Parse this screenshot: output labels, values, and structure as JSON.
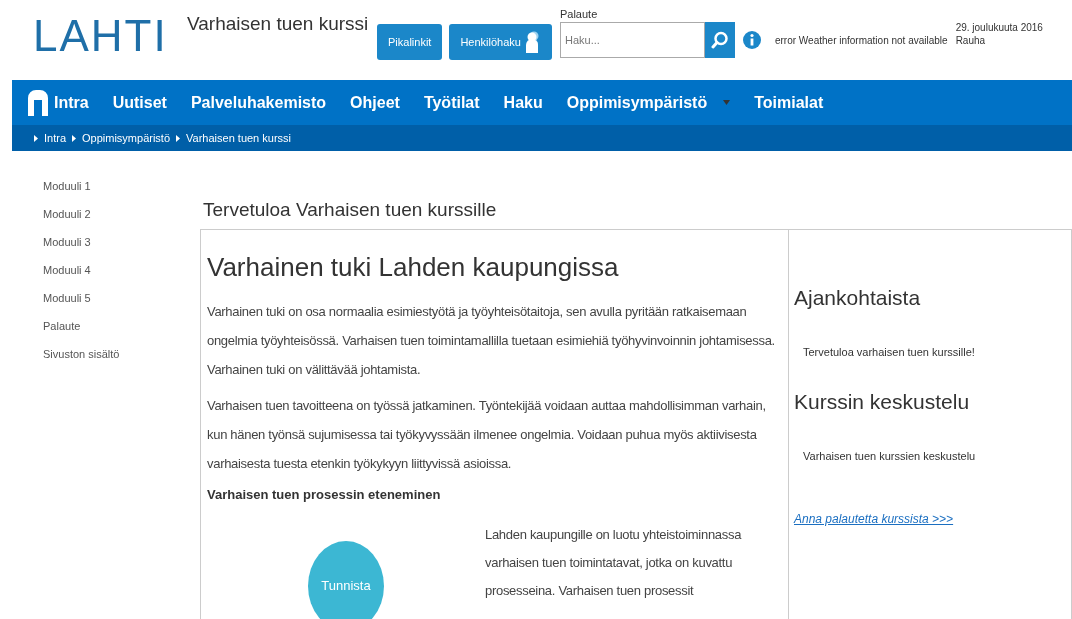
{
  "header": {
    "logo": "LAHTI",
    "site_title": "Varhaisen tuen kurssi",
    "buttons": [
      {
        "label": "Pikalinkit",
        "kind": "plain"
      },
      {
        "label": "Henkilöhaku",
        "kind": "person"
      }
    ],
    "search": {
      "label": "Palaute",
      "placeholder": "Haku..."
    },
    "weather": "error Weather information not available",
    "date": "29. joulukuuta 2016",
    "name_day": "Rauha"
  },
  "nav": {
    "items": [
      {
        "label": "Intra",
        "kind": "home",
        "dropdown": false
      },
      {
        "label": "Uutiset",
        "kind": "link",
        "dropdown": false
      },
      {
        "label": "Palveluhakemisto",
        "kind": "link",
        "dropdown": false
      },
      {
        "label": "Ohjeet",
        "kind": "link",
        "dropdown": false
      },
      {
        "label": "Työtilat",
        "kind": "link",
        "dropdown": false
      },
      {
        "label": "Haku",
        "kind": "link",
        "dropdown": false
      },
      {
        "label": "Oppimisympäristö",
        "kind": "link",
        "dropdown": true
      },
      {
        "label": "Toimialat",
        "kind": "link",
        "dropdown": false
      }
    ]
  },
  "breadcrumb": [
    "Intra",
    "Oppimisympäristö",
    "Varhaisen tuen kurssi"
  ],
  "sidebar": {
    "items": [
      "Moduuli 1",
      "Moduuli 2",
      "Moduuli 3",
      "Moduuli 4",
      "Moduuli 5",
      "Palaute",
      "Sivuston sisältö"
    ]
  },
  "page_title": "Tervetuloa Varhaisen tuen kurssille",
  "main": {
    "heading": "Varhainen tuki Lahden kaupungissa",
    "paragraphs": [
      "Varhainen tuki on osa normaalia esimiestyötä ja työyhteisötaitoja, sen avulla pyritään ratkaisemaan ongelmia työyhteisössä. Varhaisen tuen toimintamallilla tuetaan esimiehiä työhyvinvoinnin johtamisessa. Varhainen tuki on välittävää johtamista.",
      "Varhaisen tuen tavoitteena on työssä jatkaminen. Työntekijää voidaan auttaa mahdollisimman varhain, kun hänen työnsä sujumisessa tai työkyvyssään ilmenee ongelmia. Voidaan puhua myös aktiivisesta varhaisesta tuesta etenkin työkykyyn liittyvissä asioissa."
    ],
    "subheading": "Varhaisen tuen prosessin eteneminen",
    "process_step": "Tunnista",
    "process_text": "Lahden kaupungille on luotu yhteistoiminnassa varhaisen tuen toimintatavat, jotka on kuvattu prosesseina. Varhaisen tuen prosessit"
  },
  "aside": {
    "sections": [
      {
        "title": "Ajankohtaista",
        "text": "Tervetuloa varhaisen tuen kurssille!"
      },
      {
        "title": "Kurssin keskustelu",
        "text": "Varhaisen tuen kurssien keskustelu"
      }
    ],
    "link": "Anna palautetta kurssista >>>"
  }
}
